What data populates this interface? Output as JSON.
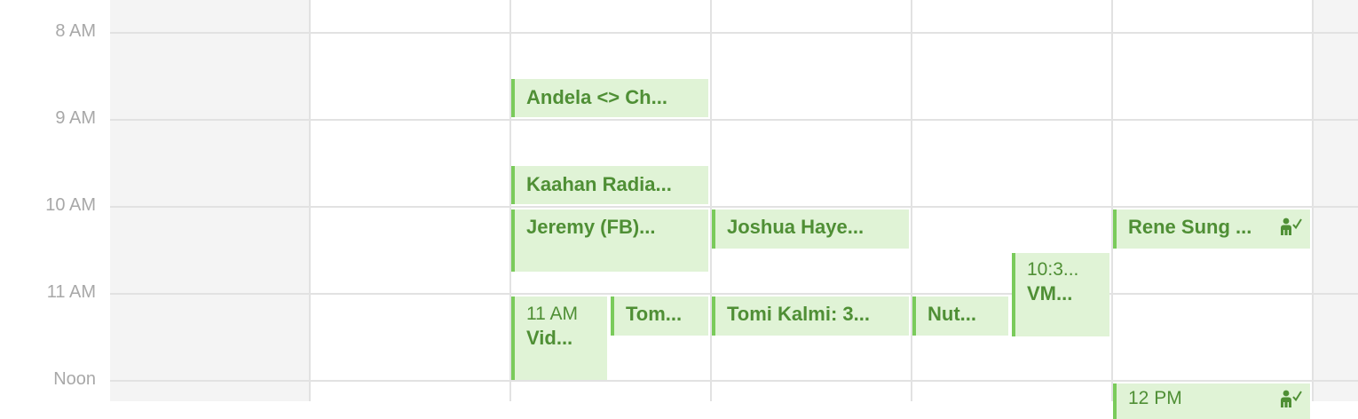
{
  "hours": [
    "8 AM",
    "9 AM",
    "10 AM",
    "11 AM",
    "Noon"
  ],
  "colors": {
    "event_bg": "#e0f3d6",
    "event_bar": "#7acb5b",
    "event_text": "#4f8f35",
    "grid": "#e2e2e2",
    "weekend_bg": "#f4f4f4"
  },
  "events": {
    "andela": {
      "title": "Andela <> Ch..."
    },
    "kaahan": {
      "title": "Kaahan Radia..."
    },
    "jeremy": {
      "title": "Jeremy (FB)..."
    },
    "joshua": {
      "title": "Joshua Haye..."
    },
    "rene": {
      "title": "Rene Sung  ...",
      "icon": "attendee-accepted-icon"
    },
    "vm": {
      "time": "10:3...",
      "title": "VM..."
    },
    "vid": {
      "time": "11 AM",
      "title": "Vid..."
    },
    "tom": {
      "title": "Tom..."
    },
    "tomi": {
      "title": "Tomi Kalmi: 3..."
    },
    "nut": {
      "title": "Nut..."
    },
    "noon": {
      "time": "12 PM",
      "icon": "attendee-accepted-icon"
    }
  }
}
